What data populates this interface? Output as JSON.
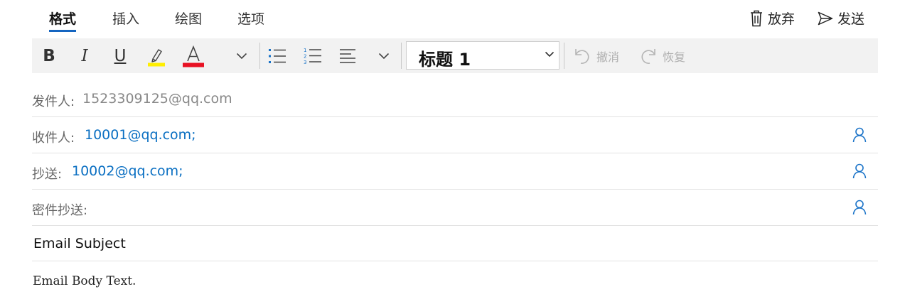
{
  "tabs": [
    {
      "label": "格式",
      "active": true
    },
    {
      "label": "插入",
      "active": false
    },
    {
      "label": "绘图",
      "active": false
    },
    {
      "label": "选项",
      "active": false
    }
  ],
  "actions": {
    "discard_label": "放弃",
    "send_label": "发送"
  },
  "toolbar": {
    "bold_label": "B",
    "italic_label": "I",
    "underline_label": "U",
    "font_color_label": "A",
    "highlight_color": "#ffee00",
    "font_color": "#e81123",
    "style_value": "标题 1",
    "undo_label": "撤消",
    "redo_label": "恢复"
  },
  "fields": {
    "from": {
      "label": "发件人:",
      "value": "1523309125@qq.com"
    },
    "to": {
      "label": "收件人:",
      "value": "10001@qq.com;"
    },
    "cc": {
      "label": "抄送:",
      "value": "10002@qq.com;"
    },
    "bcc": {
      "label": "密件抄送:",
      "value": ""
    }
  },
  "subject": "Email Subject",
  "body": "Email Body Text.",
  "colors": {
    "accent": "#1565c0",
    "link": "#0a6fc2",
    "toolbar_bg": "#f2f2f2"
  }
}
